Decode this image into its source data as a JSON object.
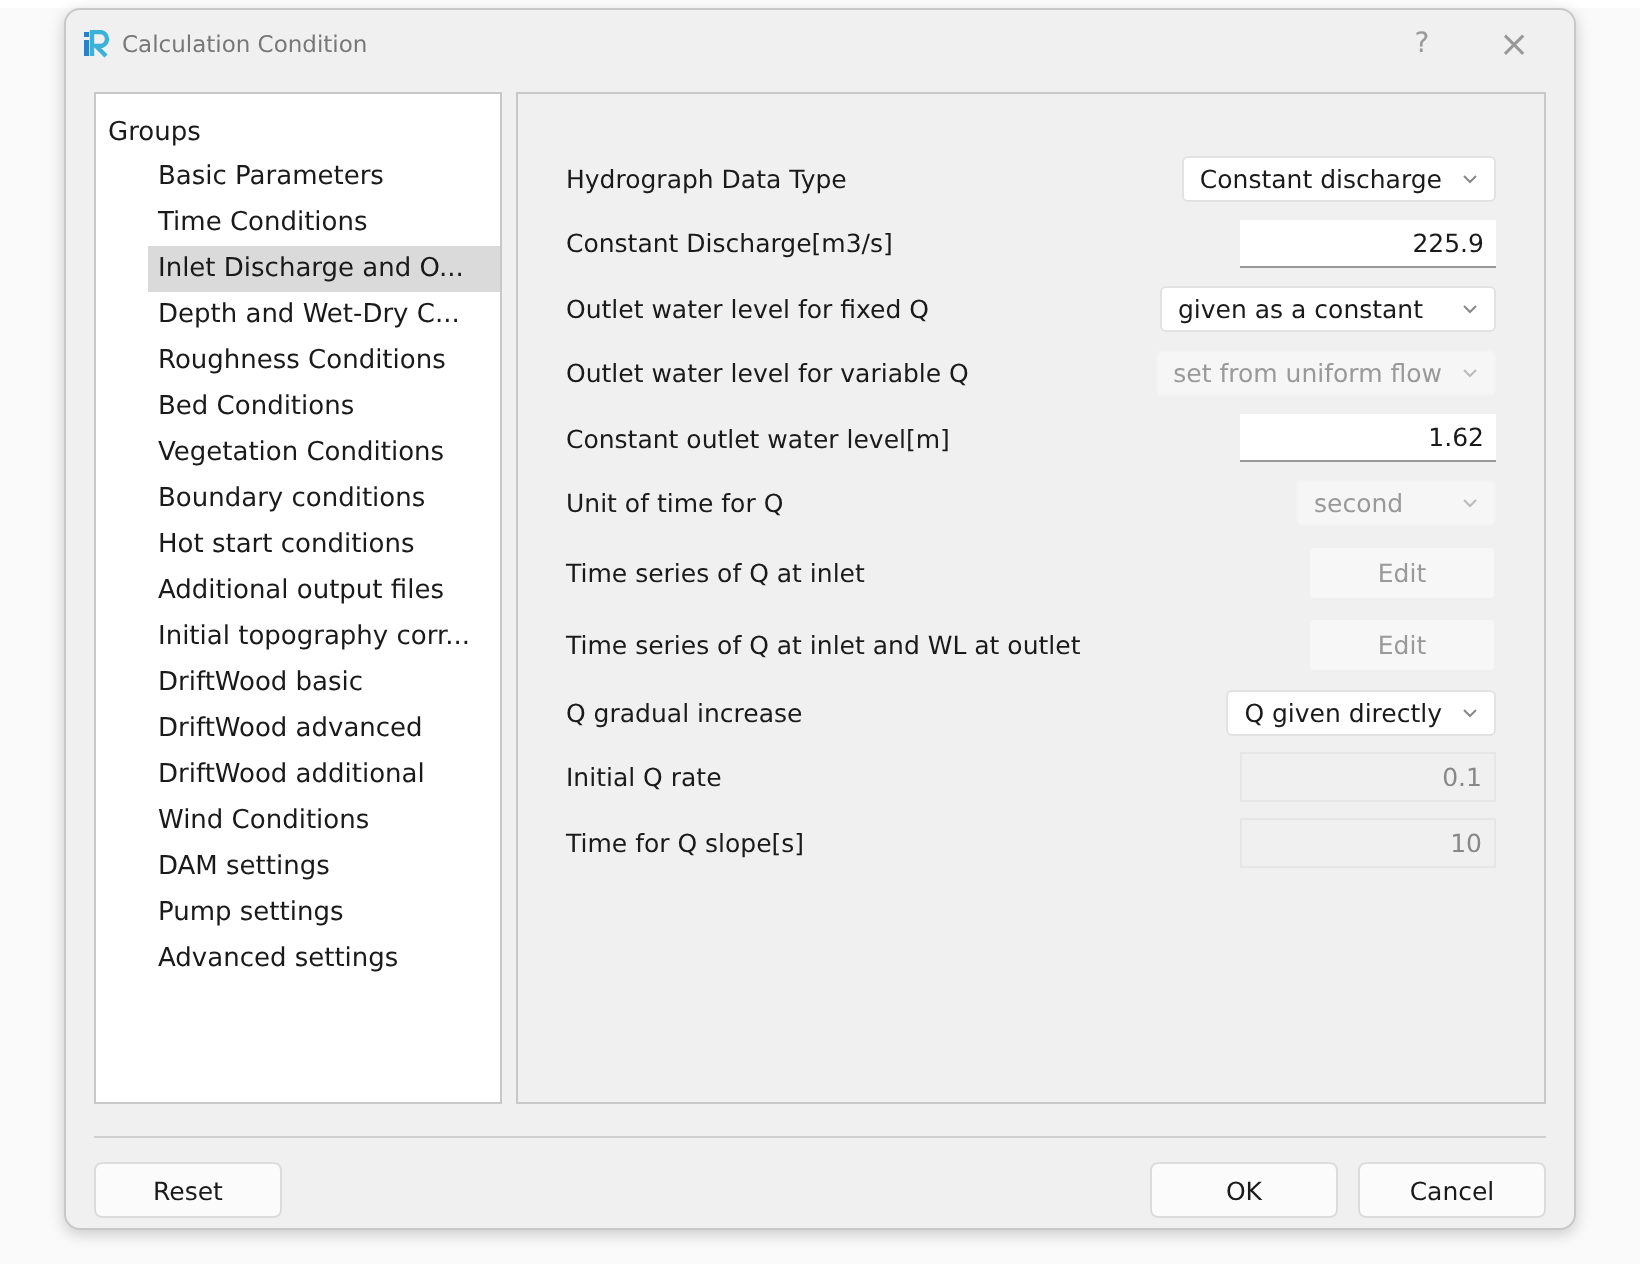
{
  "window": {
    "title": "Calculation Condition",
    "help": "?",
    "close": "×"
  },
  "sidebar": {
    "header": "Groups",
    "items": [
      {
        "label": "Basic Parameters",
        "selected": false
      },
      {
        "label": "Time Conditions",
        "selected": false
      },
      {
        "label": "Inlet Discharge and O...",
        "selected": true
      },
      {
        "label": "Depth and Wet-Dry C...",
        "selected": false
      },
      {
        "label": "Roughness Conditions",
        "selected": false
      },
      {
        "label": "Bed Conditions",
        "selected": false
      },
      {
        "label": "Vegetation Conditions",
        "selected": false
      },
      {
        "label": "Boundary conditions",
        "selected": false
      },
      {
        "label": "Hot start conditions",
        "selected": false
      },
      {
        "label": "Additional output files",
        "selected": false
      },
      {
        "label": "Initial topography corr...",
        "selected": false
      },
      {
        "label": "DriftWood basic",
        "selected": false
      },
      {
        "label": "DriftWood advanced",
        "selected": false
      },
      {
        "label": "DriftWood additional",
        "selected": false
      },
      {
        "label": "Wind Conditions",
        "selected": false
      },
      {
        "label": "DAM settings",
        "selected": false
      },
      {
        "label": "Pump settings",
        "selected": false
      },
      {
        "label": "Advanced settings",
        "selected": false
      }
    ]
  },
  "fields": [
    {
      "label": "Hydrograph Data Type",
      "kind": "combo",
      "value": "Constant discharge",
      "disabled": false
    },
    {
      "label": "Constant Discharge[m3/s]",
      "kind": "text",
      "value": "225.9",
      "disabled": false
    },
    {
      "label": "Outlet water level for fixed Q",
      "kind": "combo",
      "value": "given as a constant",
      "disabled": false
    },
    {
      "label": "Outlet water level for variable Q",
      "kind": "combo",
      "value": "set from uniform flow",
      "disabled": true
    },
    {
      "label": "Constant outlet water level[m]",
      "kind": "text",
      "value": "1.62",
      "disabled": false
    },
    {
      "label": "Unit of time for Q",
      "kind": "combo",
      "value": "second",
      "disabled": true
    },
    {
      "label": "Time series of Q at inlet",
      "kind": "button",
      "value": "Edit",
      "disabled": true
    },
    {
      "label": "Time series of Q at inlet and WL at outlet",
      "kind": "button",
      "value": "Edit",
      "disabled": true
    },
    {
      "label": "Q gradual increase",
      "kind": "combo",
      "value": "Q given directly",
      "disabled": false
    },
    {
      "label": "Initial Q rate",
      "kind": "text",
      "value": "0.1",
      "disabled": true
    },
    {
      "label": "Time for Q slope[s]",
      "kind": "text",
      "value": "10",
      "disabled": true
    }
  ],
  "buttons": {
    "left": [
      "Reset"
    ],
    "right": [
      "OK",
      "Cancel"
    ]
  }
}
